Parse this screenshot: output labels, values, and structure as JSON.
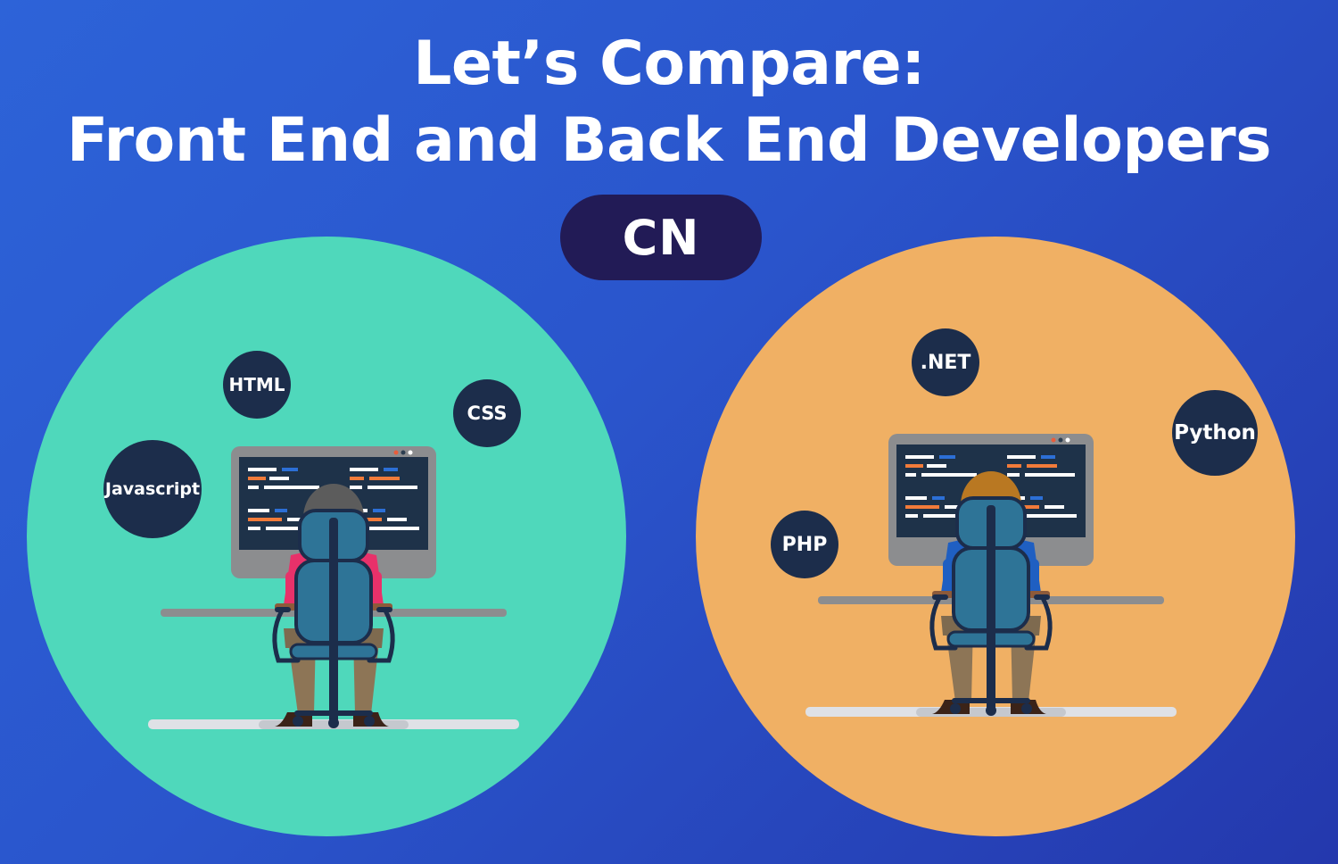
{
  "title": {
    "line1": "Let’s Compare:",
    "line2": "Front End and Back End Developers"
  },
  "logo": {
    "text": "CN"
  },
  "frontend": {
    "circle_color": "#4fd8bb",
    "shirt_color": "#e8316a",
    "hair_color": "#5c5c5c",
    "badges": [
      "HTML",
      "CSS",
      "Javascript"
    ]
  },
  "backend": {
    "circle_color": "#f0b064",
    "shirt_color": "#1f5fc2",
    "hair_color": "#b97822",
    "badges": [
      ".NET",
      "Python",
      "PHP"
    ]
  },
  "colors": {
    "background": "#2a55cc",
    "badge": "#1c2d4b",
    "logo_pill": "#221b56",
    "code_orange": "#f27b3a",
    "code_blue": "#2c6fd6"
  }
}
